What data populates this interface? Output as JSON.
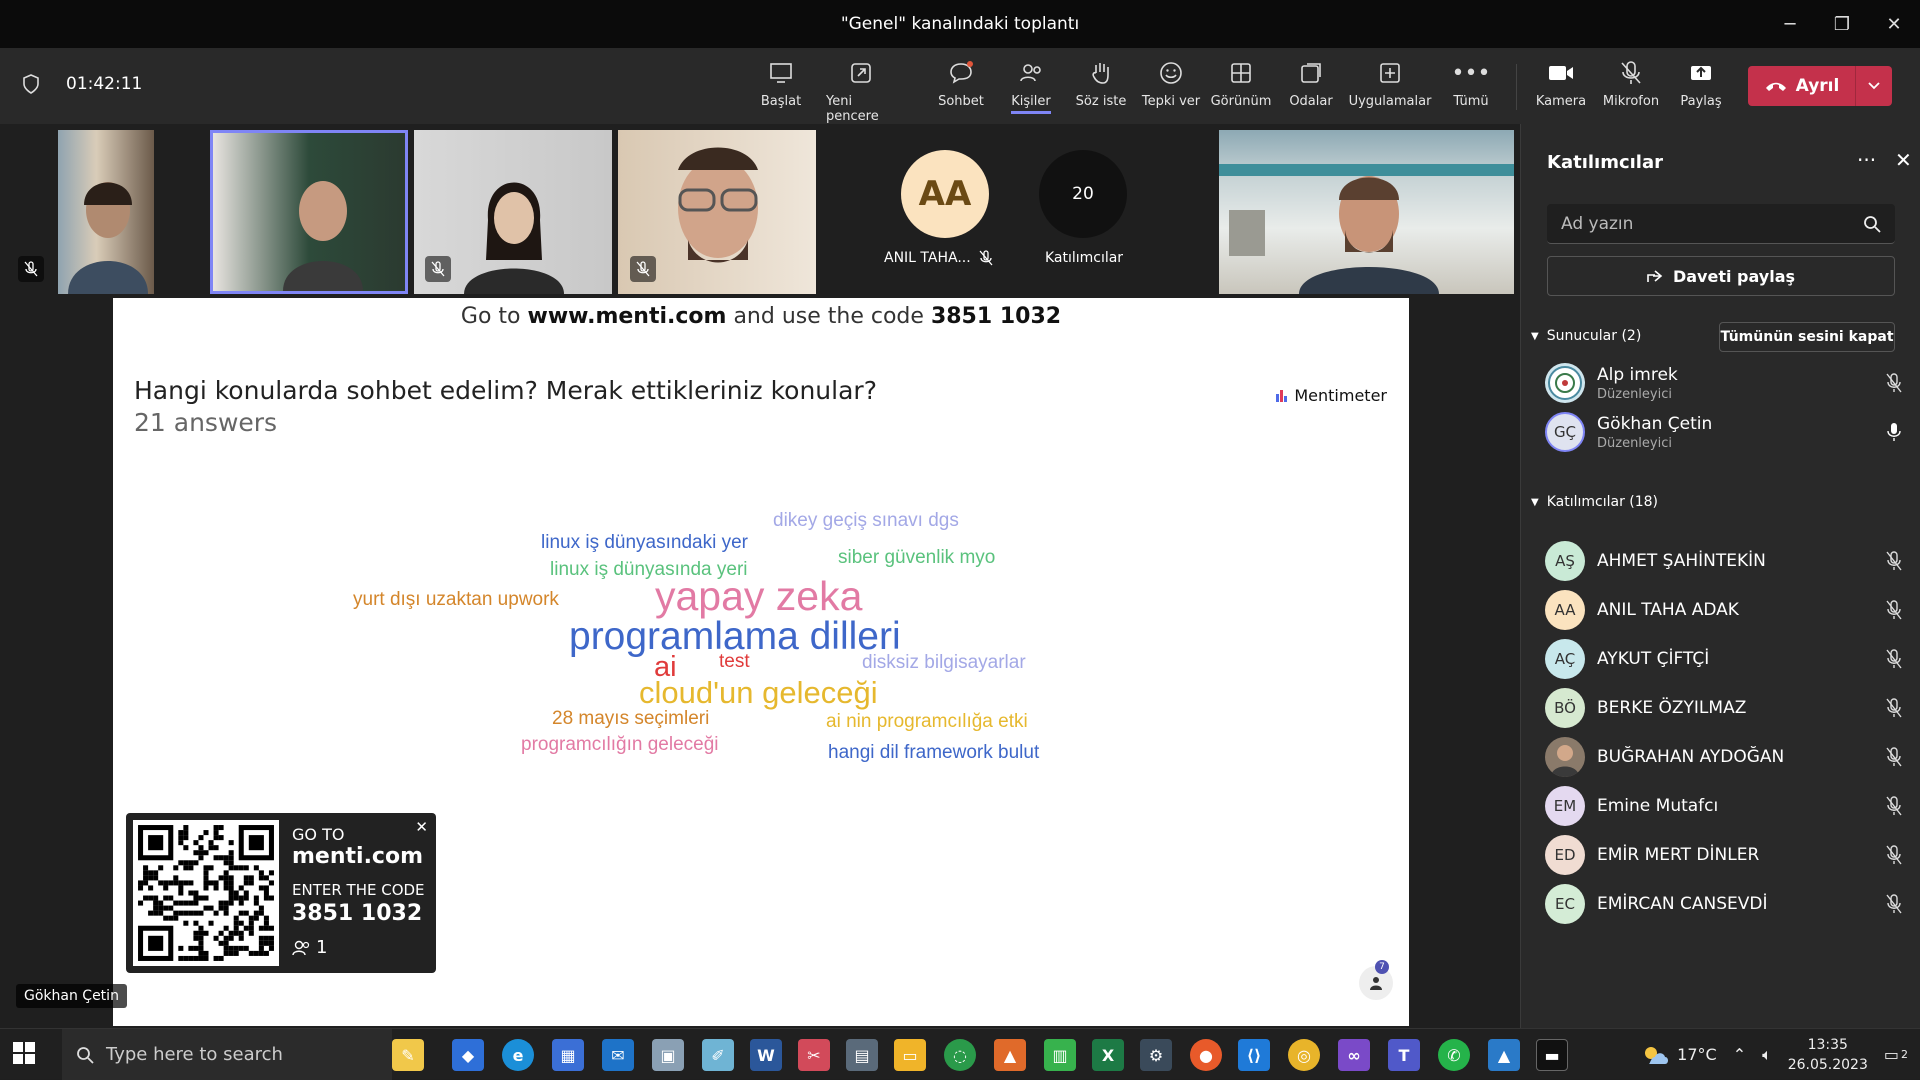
{
  "window": {
    "title": "\"Genel\" kanalındaki toplantı",
    "minimize": "─",
    "maximize": "❐",
    "close": "✕"
  },
  "toolbar": {
    "timer": "01:42:11",
    "buttons": {
      "start": "Başlat",
      "new_window": "Yeni pencere",
      "chat": "Sohbet",
      "people": "Kişiler",
      "raise_hand": "Söz iste",
      "react": "Tepki ver",
      "view": "Görünüm",
      "rooms": "Odalar",
      "apps": "Uygulamalar",
      "more": "Tümü",
      "camera": "Kamera",
      "mic": "Mikrofon",
      "share": "Paylaş"
    },
    "leave": "Ayrıl",
    "colors": {
      "leave": "#c4314b",
      "accent": "#7f85f5"
    }
  },
  "gallery": {
    "aa_initials": "AA",
    "aa_name": "ANIL TAHA...",
    "count": "20",
    "count_label": "Katılımcılar"
  },
  "slide": {
    "goto_prefix": "Go to",
    "goto_url": "www.menti.com",
    "goto_mid": "and use the code",
    "goto_code": "3851 1032",
    "question": "Hangi konularda sohbet edelim? Merak ettikleriniz konular?",
    "answers": "21 answers",
    "brand": "Mentimeter",
    "words": [
      {
        "text": "dikey geçiş sınavı dgs",
        "color": "#a3a8e6"
      },
      {
        "text": "linux iş dünyasındaki yer",
        "color": "#3e67c9"
      },
      {
        "text": "siber güvenlik myo",
        "color": "#5ac27d"
      },
      {
        "text": "linux iş dünyasında yeri",
        "color": "#5ac27d"
      },
      {
        "text": "yurt dışı uzaktan upwork",
        "color": "#d4862b"
      },
      {
        "text": "yapay zeka",
        "color": "#e27aa4"
      },
      {
        "text": "programlama dilleri",
        "color": "#3e67c9"
      },
      {
        "text": "ai",
        "color": "#e03b3b"
      },
      {
        "text": "test",
        "color": "#e03b3b"
      },
      {
        "text": "disksiz bilgisayarlar",
        "color": "#a3a8e6"
      },
      {
        "text": "cloud'un geleceği",
        "color": "#e6b82e"
      },
      {
        "text": "28 mayıs seçimleri",
        "color": "#d4862b"
      },
      {
        "text": "ai nin programcılığa etki",
        "color": "#e6b82e"
      },
      {
        "text": "programcılığın geleceği",
        "color": "#e27aa4"
      },
      {
        "text": "hangi dil framework bulut",
        "color": "#3e67c9"
      }
    ],
    "qr": {
      "line1": "GO TO",
      "line2": "menti.com",
      "line3": "ENTER THE CODE",
      "line4": "3851 1032",
      "count": "1"
    },
    "viewer_badge": "7",
    "presenter_tag": "Gökhan Çetin"
  },
  "panel": {
    "title": "Katılımcılar",
    "search_placeholder": "Ad yazın",
    "invite": "Daveti paylaş",
    "presenters_header": "Sunucular (2)",
    "mute_all": "Tümünün sesini kapat",
    "attendees_header": "Katılımcılar (18)",
    "presenters": [
      {
        "name": "Alp imrek",
        "role": "Düzenleyici",
        "initials": "",
        "bg": "#cfe6ee"
      },
      {
        "name": "Gökhan Çetin",
        "role": "Düzenleyici",
        "initials": "GÇ",
        "bg": "#dfe3f0"
      }
    ],
    "attendees": [
      {
        "name": "AHMET ŞAHİNTEKİN",
        "initials": "AŞ",
        "bg": "#c9ead6"
      },
      {
        "name": "ANIL TAHA ADAK",
        "initials": "AA",
        "bg": "#fbe3bf"
      },
      {
        "name": "AYKUT ÇİFTÇİ",
        "initials": "AÇ",
        "bg": "#c8e8ec"
      },
      {
        "name": "BERKE ÖZYILMAZ",
        "initials": "BÖ",
        "bg": "#d6e9d0"
      },
      {
        "name": "BUĞRAHAN AYDOĞAN",
        "initials": "",
        "bg": "#8a7a6a"
      },
      {
        "name": "Emine Mutafcı",
        "initials": "EM",
        "bg": "#e4d9f0"
      },
      {
        "name": "EMİR MERT DİNLER",
        "initials": "ED",
        "bg": "#f0dcd2"
      },
      {
        "name": "EMİRCAN CANSEVDİ",
        "initials": "EC",
        "bg": "#d4ecd6"
      }
    ]
  },
  "taskbar": {
    "search": "Type here to search",
    "weather": "17°C",
    "time": "13:35",
    "date": "26.05.2023",
    "notif": "2"
  }
}
